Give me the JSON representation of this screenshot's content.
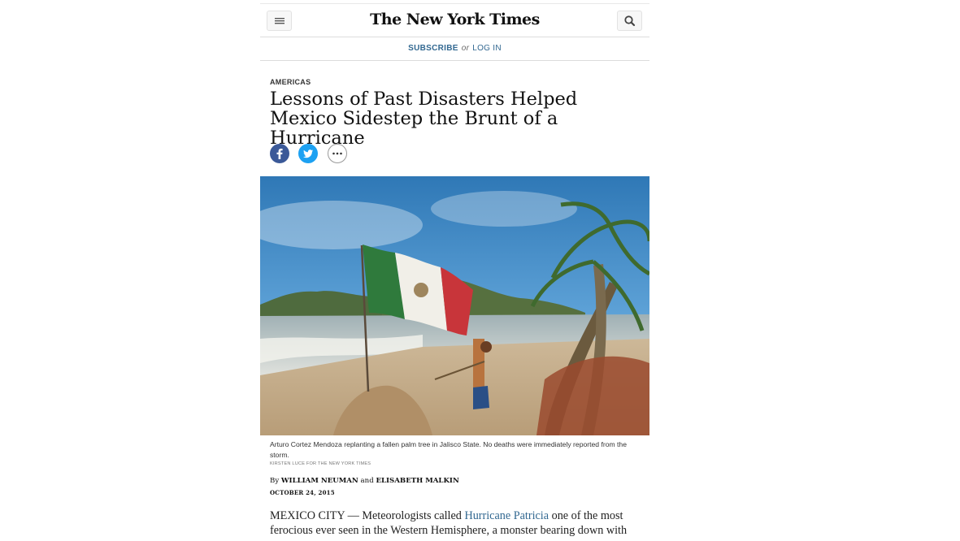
{
  "header": {
    "logo": "The New York Times",
    "menu_icon": "hamburger-menu-icon",
    "search_icon": "search-icon"
  },
  "subscribe_bar": {
    "subscribe": "SUBSCRIBE",
    "or": "or",
    "login": "LOG IN"
  },
  "article": {
    "kicker": "AMERICAS",
    "headline": "Lessons of Past Disasters Helped Mexico Sidestep the Brunt of a Hurricane",
    "share": {
      "facebook_icon": "facebook-icon",
      "twitter_icon": "twitter-icon",
      "more_icon": "more-options-icon"
    },
    "photo": {
      "caption": "Arturo Cortez Mendoza replanting a fallen palm tree in Jalisco State. No deaths were immediately reported from the storm.",
      "credit": "KIRSTEN LUCE FOR THE NEW YORK TIMES"
    },
    "byline": {
      "prefix": "By",
      "author1": "WILLIAM NEUMAN",
      "and": "and",
      "author2": "ELISABETH MALKIN"
    },
    "date": "OCTOBER 24, 2015",
    "body": {
      "lead": "MEXICO CITY — Meteorologists called ",
      "link": "Hurricane Patricia",
      "rest": " one of the most ferocious ever seen in the Western Hemisphere, a monster bearing down with"
    }
  },
  "colors": {
    "link": "#326891",
    "facebook": "#3b5998",
    "twitter": "#1da1f2"
  }
}
